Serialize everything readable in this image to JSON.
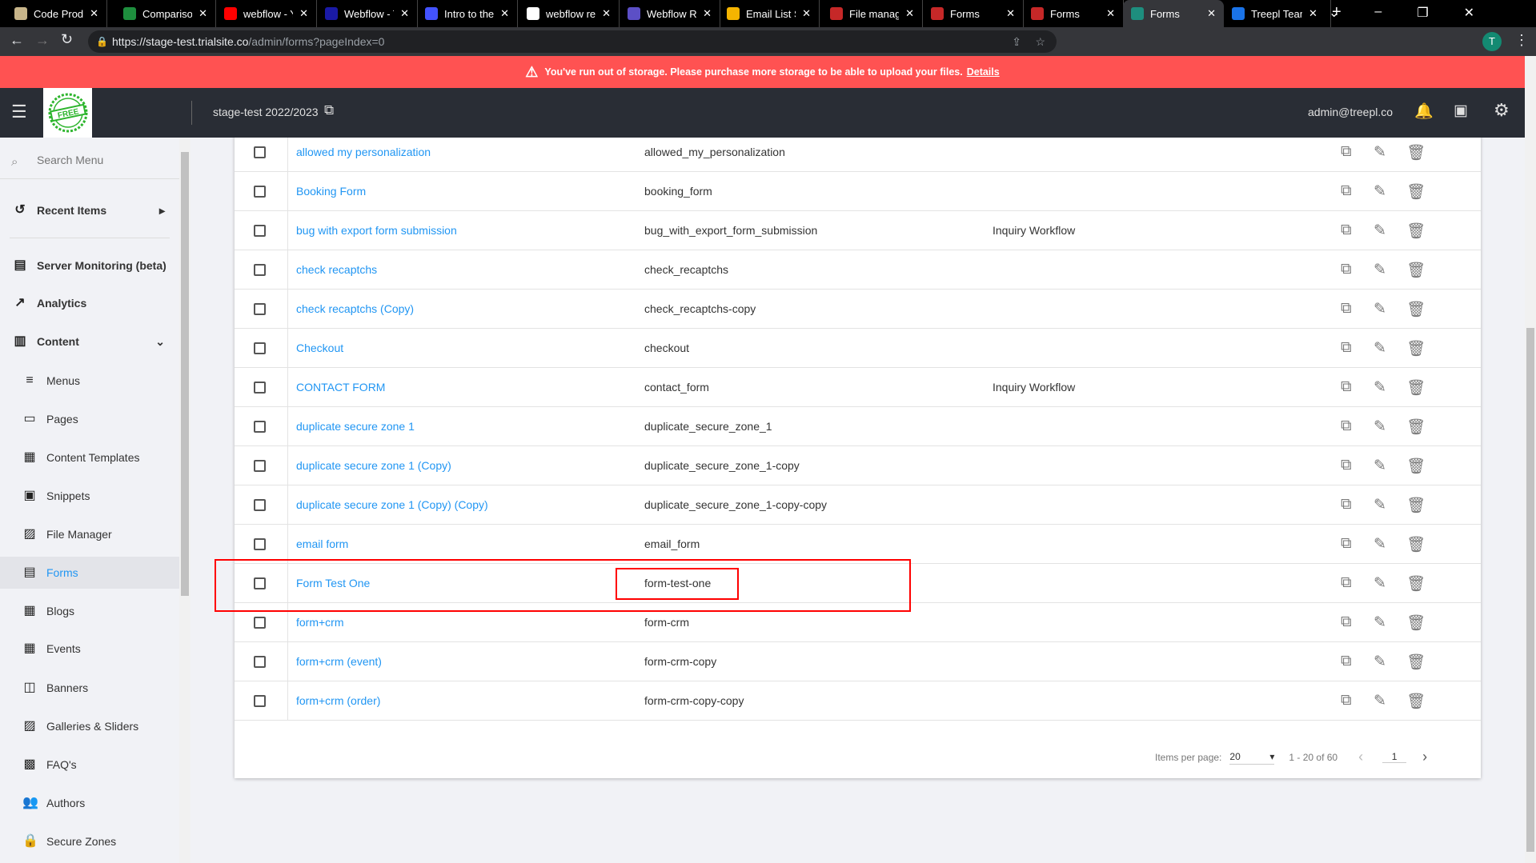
{
  "browser": {
    "tabs": [
      {
        "title": "Code Produ",
        "color": "#c8b58a"
      },
      {
        "title": "Comparison",
        "color": "#1e8e3e"
      },
      {
        "title": "webflow - Y",
        "color": "#ff0000"
      },
      {
        "title": "Webflow - T",
        "color": "#1a1aa6"
      },
      {
        "title": "Intro to the",
        "color": "#4353ff"
      },
      {
        "title": "webflow re",
        "color": "#ffffff"
      },
      {
        "title": "Webflow Re",
        "color": "#5c4fc6"
      },
      {
        "title": "Email List S",
        "color": "#f5b400"
      },
      {
        "title": "File manag",
        "color": "#c62828"
      },
      {
        "title": "Forms",
        "color": "#c62828"
      },
      {
        "title": "Forms",
        "color": "#c62828"
      },
      {
        "title": "Forms",
        "color": "#1e8e7e",
        "active": true
      },
      {
        "title": "Treepl Team",
        "color": "#1a73e8"
      }
    ],
    "url_host": "https://stage-test.trialsite.co",
    "url_path": "/admin/forms?pageIndex=0",
    "profile": "T"
  },
  "banner": {
    "text": "You've run out of storage. Please purchase more storage to be able to upload your files.",
    "link": "Details"
  },
  "header": {
    "logo_text": "BUY ONE GET ONE FREE",
    "site": "stage-test 2022/2023",
    "user": "admin@treepl.co"
  },
  "sidebar": {
    "search_placeholder": "Search Menu",
    "items": [
      {
        "label": "Recent Items",
        "icon": "history-icon",
        "type": "top",
        "arrow": "▸"
      },
      {
        "label": "Server Monitoring (beta)",
        "icon": "server-icon",
        "type": "top"
      },
      {
        "label": "Analytics",
        "icon": "trending-up-icon",
        "type": "top"
      },
      {
        "label": "Content",
        "icon": "columns-icon",
        "type": "top",
        "arrow": "⌄"
      },
      {
        "label": "Menus",
        "icon": "menu-icon",
        "type": "sub"
      },
      {
        "label": "Pages",
        "icon": "page-icon",
        "type": "sub"
      },
      {
        "label": "Content Templates",
        "icon": "template-icon",
        "type": "sub"
      },
      {
        "label": "Snippets",
        "icon": "snippet-icon",
        "type": "sub"
      },
      {
        "label": "File Manager",
        "icon": "image-icon",
        "type": "sub"
      },
      {
        "label": "Forms",
        "icon": "form-icon",
        "type": "sub",
        "active": true
      },
      {
        "label": "Blogs",
        "icon": "calendar-icon",
        "type": "sub"
      },
      {
        "label": "Events",
        "icon": "event-icon",
        "type": "sub"
      },
      {
        "label": "Banners",
        "icon": "banner-icon",
        "type": "sub"
      },
      {
        "label": "Galleries & Sliders",
        "icon": "gallery-icon",
        "type": "sub"
      },
      {
        "label": "FAQ's",
        "icon": "forum-icon",
        "type": "sub"
      },
      {
        "label": "Authors",
        "icon": "people-icon",
        "type": "sub"
      },
      {
        "label": "Secure Zones",
        "icon": "lock-icon",
        "type": "sub"
      }
    ]
  },
  "table": {
    "rows": [
      {
        "name": "allowed my personalization",
        "key": "allowed_my_personalization",
        "workflow": ""
      },
      {
        "name": "Booking Form",
        "key": "booking_form",
        "workflow": ""
      },
      {
        "name": "bug with export form submission",
        "key": "bug_with_export_form_submission",
        "workflow": "Inquiry Workflow"
      },
      {
        "name": "check recaptchs",
        "key": "check_recaptchs",
        "workflow": ""
      },
      {
        "name": "check recaptchs (Copy)",
        "key": "check_recaptchs-copy",
        "workflow": ""
      },
      {
        "name": "Checkout",
        "key": "checkout",
        "workflow": ""
      },
      {
        "name": "CONTACT FORM",
        "key": "contact_form",
        "workflow": "Inquiry Workflow"
      },
      {
        "name": "duplicate secure zone 1",
        "key": "duplicate_secure_zone_1",
        "workflow": ""
      },
      {
        "name": "duplicate secure zone 1 (Copy)",
        "key": "duplicate_secure_zone_1-copy",
        "workflow": ""
      },
      {
        "name": "duplicate secure zone 1 (Copy) (Copy)",
        "key": "duplicate_secure_zone_1-copy-copy",
        "workflow": ""
      },
      {
        "name": "email form",
        "key": "email_form",
        "workflow": ""
      },
      {
        "name": "Form Test One",
        "key": "form-test-one",
        "workflow": "",
        "highlighted": true
      },
      {
        "name": "form+crm",
        "key": "form-crm",
        "workflow": ""
      },
      {
        "name": "form+crm (event)",
        "key": "form-crm-copy",
        "workflow": ""
      },
      {
        "name": "form+crm (order)",
        "key": "form-crm-copy-copy",
        "workflow": ""
      }
    ]
  },
  "pagination": {
    "label": "Items per page:",
    "per_page": "20",
    "range": "1 - 20 of 60",
    "page": "1"
  },
  "colors": {
    "banner": "#ff5252",
    "header": "#292d35",
    "link": "#2196f3",
    "highlight": "#ff0000"
  }
}
